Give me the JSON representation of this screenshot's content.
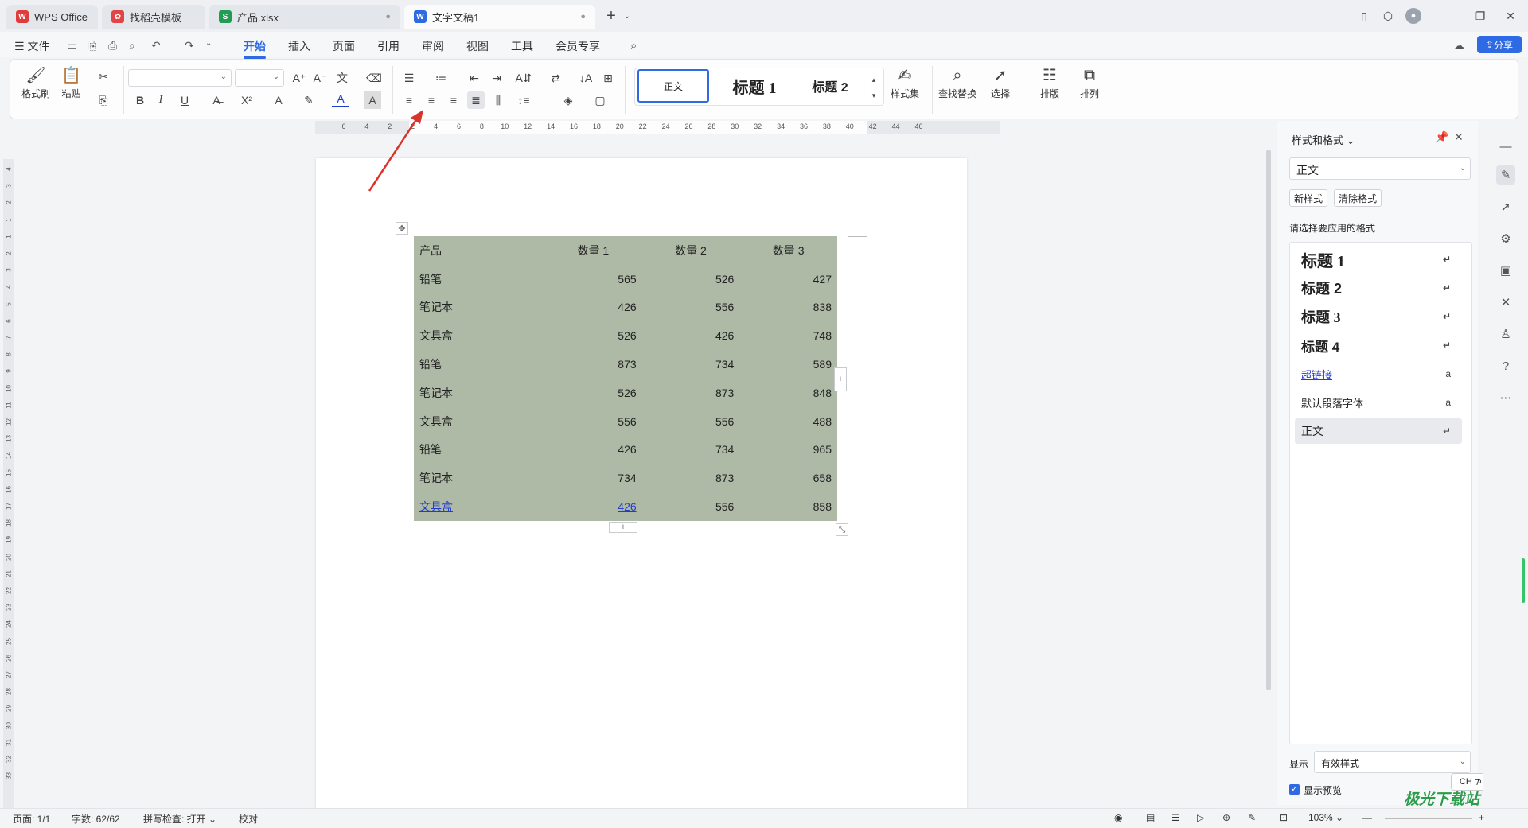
{
  "tabs": [
    {
      "label": "WPS Office",
      "icon": "wps-logo-icon",
      "color": "#e03b3b"
    },
    {
      "label": "找稻壳模板",
      "icon": "docer-icon",
      "color": "#e24545"
    },
    {
      "label": "产品.xlsx",
      "icon": "spreadsheet-icon",
      "color": "#1f9d55"
    },
    {
      "label": "文字文稿1",
      "icon": "writer-icon",
      "color": "#2d6ae3"
    }
  ],
  "menu": {
    "file": "文件",
    "items": [
      "开始",
      "插入",
      "页面",
      "引用",
      "审阅",
      "视图",
      "工具",
      "会员专享"
    ],
    "active": "开始",
    "share": "分享"
  },
  "ribbon": {
    "format_painter": "格式刷",
    "paste": "粘贴",
    "bold": "B",
    "italic": "I",
    "underline": "U",
    "styles": [
      {
        "label": "正文"
      },
      {
        "label": "标题 1"
      },
      {
        "label": "标题 2"
      }
    ],
    "style_set": "样式集",
    "find_replace": "查找替换",
    "select": "选择",
    "layout": "排版",
    "arrange": "排列"
  },
  "ruler": {
    "h_ticks": [
      "6",
      "4",
      "2",
      "2",
      "4",
      "6",
      "8",
      "10",
      "12",
      "14",
      "16",
      "18",
      "20",
      "22",
      "24",
      "26",
      "28",
      "30",
      "32",
      "34",
      "36",
      "38",
      "40",
      "42",
      "44",
      "46"
    ],
    "v_ticks": [
      "4",
      "3",
      "2",
      "1",
      "1",
      "2",
      "3",
      "4",
      "5",
      "6",
      "7",
      "8",
      "9",
      "10",
      "11",
      "12",
      "13",
      "14",
      "15",
      "16",
      "17",
      "18",
      "19",
      "20",
      "21",
      "22",
      "23",
      "24",
      "25",
      "26",
      "27",
      "28",
      "29",
      "30",
      "31",
      "32",
      "33"
    ]
  },
  "table": {
    "headers": [
      "产品",
      "数量 1",
      "数量 2",
      "数量 3"
    ],
    "rows": [
      [
        "铅笔",
        "565",
        "526",
        "427"
      ],
      [
        "笔记本",
        "426",
        "556",
        "838"
      ],
      [
        "文具盒",
        "526",
        "426",
        "748"
      ],
      [
        "铅笔",
        "873",
        "734",
        "589"
      ],
      [
        "笔记本",
        "526",
        "873",
        "848"
      ],
      [
        "文具盒",
        "556",
        "556",
        "488"
      ],
      [
        "铅笔",
        "426",
        "734",
        "965"
      ],
      [
        "笔记本",
        "734",
        "873",
        "658"
      ],
      [
        "文具盒",
        "426",
        "556",
        "858"
      ]
    ],
    "color": "#aeb9a6"
  },
  "panel": {
    "title": "样式和格式",
    "current_style": "正文",
    "new_style": "新样式",
    "clear_format": "清除格式",
    "prompt": "请选择要应用的格式",
    "styles": [
      {
        "label": "标题  1"
      },
      {
        "label": "标题  2"
      },
      {
        "label": "标题  3"
      },
      {
        "label": "标题  4"
      },
      {
        "label": "超链接"
      },
      {
        "label": "默认段落字体"
      },
      {
        "label": "正文"
      }
    ],
    "show_label": "显示",
    "show_value": "有效样式",
    "preview_label": "显示预览",
    "ime": "CH ⊅ 简"
  },
  "status": {
    "page": "页面: 1/1",
    "words": "字数: 62/62",
    "spell": "拼写检查: 打开",
    "proof": "校对",
    "zoom": "103%"
  },
  "watermark": "极光下载站"
}
